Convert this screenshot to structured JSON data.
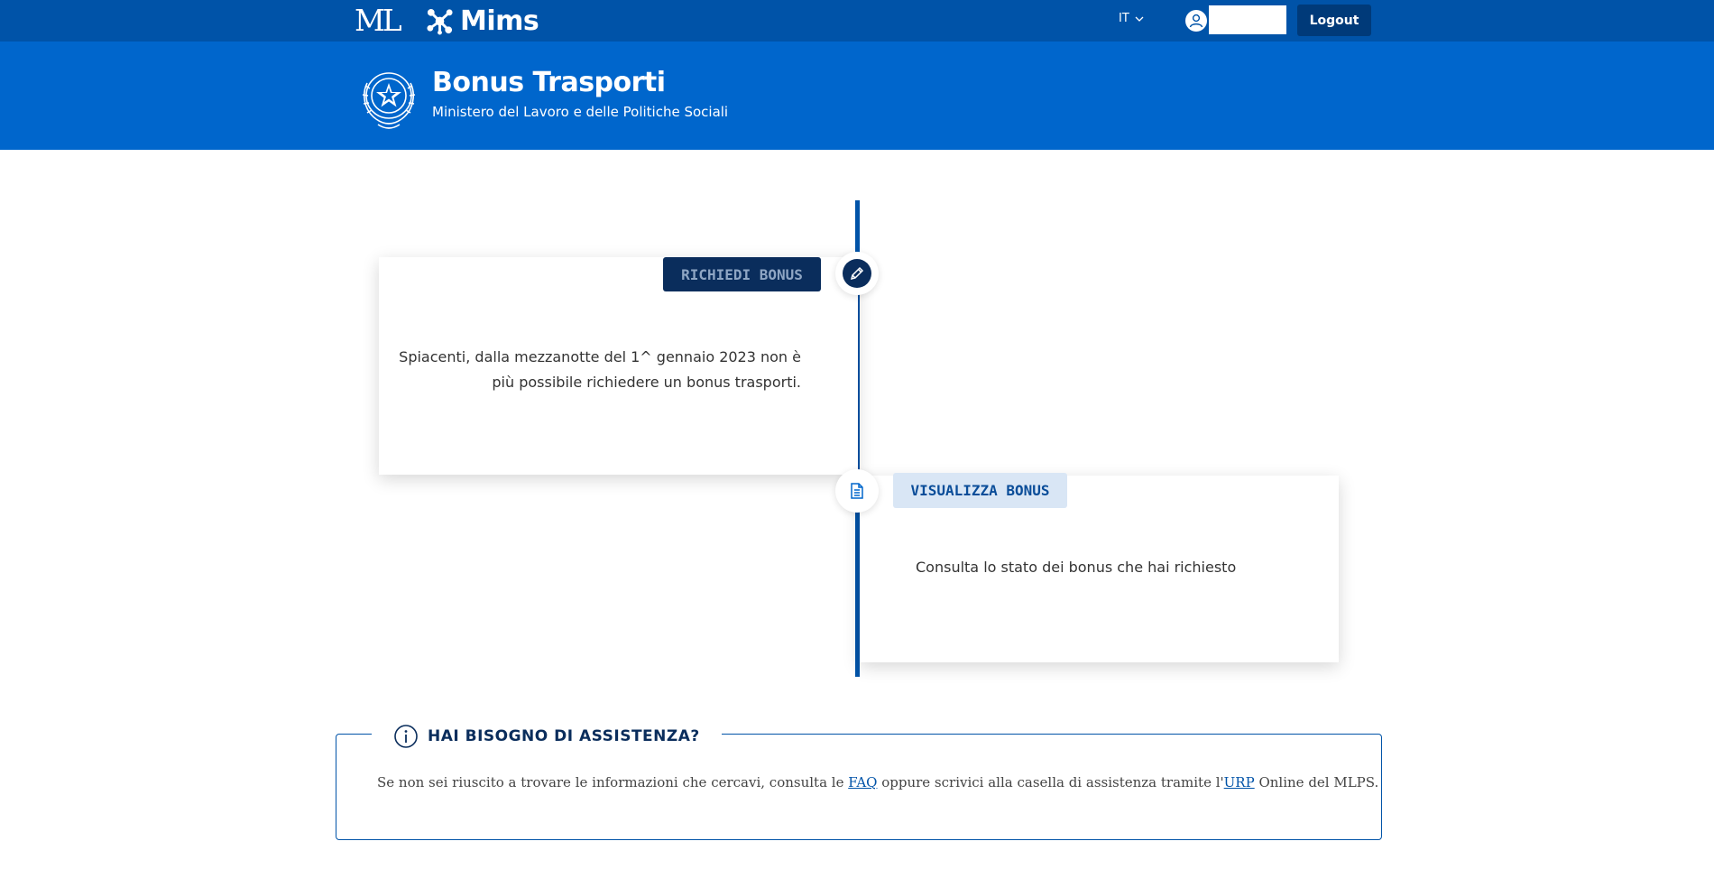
{
  "topbar": {
    "ml_logo": "ML",
    "mims_logo": "Mims",
    "language": "IT",
    "user_name": "",
    "logout_label": "Logout",
    "icons": [
      "ml-logo",
      "mims-network-icon",
      "chevron-down-icon",
      "user-icon"
    ]
  },
  "header": {
    "title": "Bonus Trasporti",
    "subtitle": "Ministero del Lavoro e delle Politiche Sociali",
    "emblem": "italian-republic-emblem-icon"
  },
  "timeline": {
    "step1": {
      "tag": "RICHIEDI BONUS",
      "icon": "pencil-icon",
      "text": "Spiacenti, dalla mezzanotte del 1^ gennaio 2023 non è più possibile richiedere un bonus trasporti."
    },
    "step2": {
      "tag": "VISUALIZZA BONUS",
      "icon": "document-icon",
      "text": "Consulta lo stato dei bonus che hai richiesto"
    }
  },
  "assistance": {
    "title": "HAI BISOGNO DI ASSISTENZA?",
    "icon": "info-icon",
    "text_before": "Se non sei riuscito a trovare le informazioni che cercavi, consulta le ",
    "faq_link": "FAQ",
    "text_middle": " oppure scrivici alla casella di assistenza tramite l'",
    "urp_link": "URP",
    "text_after": " Online del MLPS."
  },
  "colors": {
    "topbar": "#0053a8",
    "band": "#0066cc",
    "dark_navy": "#0a2d5c",
    "light_tag": "#d9e6f5"
  }
}
